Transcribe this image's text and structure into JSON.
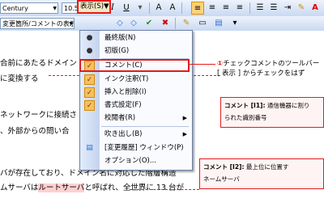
{
  "toolbar1": {
    "font_name": "Century",
    "font_size": "10.5",
    "bold_label": "B",
    "italic_label": "I",
    "underline_label": "U",
    "extra_label": "A"
  },
  "toolbar2": {
    "view_dropdown": "変更箇所/コメントの表示",
    "view_menu_label": "表示(S)▼"
  },
  "view_menu": {
    "items": [
      {
        "label": "最終版(N)",
        "icon": "bullet",
        "checked": false
      },
      {
        "label": "初版(G)",
        "icon": "bullet",
        "checked": false
      },
      {
        "label": "コメント(C)",
        "icon": "check",
        "checked": true
      },
      {
        "label": "インク注釈(T)",
        "icon": "check",
        "checked": true
      },
      {
        "label": "挿入と削除(I)",
        "icon": "check",
        "checked": true
      },
      {
        "label": "書式設定(F)",
        "icon": "check",
        "checked": true
      },
      {
        "label": "校閲者(R)",
        "icon": "none",
        "checked": false,
        "submenu": true
      },
      {
        "label": "吹き出し(B)",
        "icon": "none",
        "checked": false,
        "submenu": true
      },
      {
        "label": "[変更履歴] ウィンドウ(P)",
        "icon": "pane",
        "checked": false
      },
      {
        "label": "オプション(O)...",
        "icon": "none",
        "checked": false
      }
    ]
  },
  "callout": {
    "number": "①",
    "line1": "チェックコメントのツールバー",
    "line2": "[ 表示 ] からチェックをはず"
  },
  "document": {
    "lines": [
      "合前にあたるドメイン",
      "に変換する",
      "ネットワークに接続さ",
      "、外部からの問い合",
      "バが存在しており、ドメイン名に対応した階層構造",
      "ルートサーバ"
    ],
    "line5_prefix": "ルートサーバは",
    "line5_mark": "ルートサーバ",
    "line5_suffix": "と呼ばれ、全世界に 13 台が"
  },
  "comments": [
    {
      "tag": "コメント [I1]:",
      "text1": "通信機器に割り",
      "text2": "られた識別番号"
    },
    {
      "tag": "コメント [I2]:",
      "text1": "最上位に位置す",
      "text2": "ネームサーバ"
    }
  ]
}
